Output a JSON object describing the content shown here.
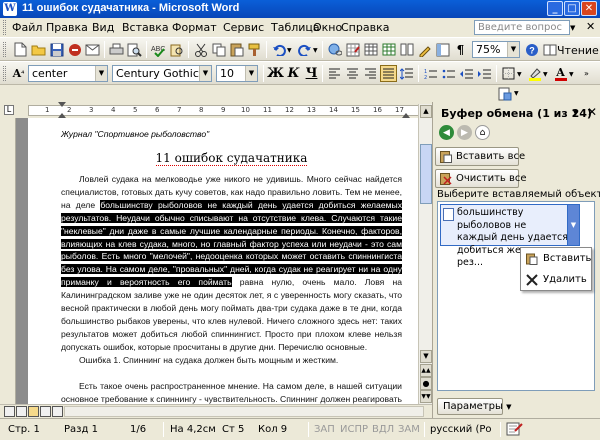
{
  "window": {
    "title": "11 ошибок судачатника - Microsoft Word"
  },
  "menu": {
    "items": [
      "Файл",
      "Правка",
      "Вид",
      "Вставка",
      "Формат",
      "Сервис",
      "Таблица",
      "Окно",
      "Справка"
    ],
    "help_placeholder": "Введите вопрос"
  },
  "standard_toolbar": {
    "zoom": "75%",
    "read_label": "Чтение"
  },
  "formatting_toolbar": {
    "style": "center",
    "font": "Century Gothic",
    "size": "10"
  },
  "ruler": {
    "numbers": [
      "1",
      "2",
      "3",
      "4",
      "5",
      "6",
      "7",
      "8",
      "9",
      "10",
      "11",
      "12",
      "13",
      "14",
      "15",
      "16",
      "17"
    ]
  },
  "document": {
    "journal": "Журнал \"Спортивное рыболовство\"",
    "title": "11 ошибок судачатника",
    "p1_before": "Ловлей судака на мелководье уже никого не удивишь. Много сейчас найдется специалистов, готовых дать кучу советов, как надо правильно ловить. Тем не менее, на деле ",
    "p1_selected": "большинству рыболовов не каждый день удается добиться желаемых результатов. Неудачи обычно списывают на отсутствие клева. Случаются такие \"неклевые\" дни даже в самые лучшие календарные периоды. Конечно, факторов, влияющих на клев судака, много, но главный фактор успеха или неудачи - это сам рыболов. Есть много \"мелочей\", недооценка которых может оставить спиннингиста без улова. На самом деле, \"провальных\" дней, когда судак не реагирует ни на одну приманку и вероятность его поймать",
    "p1_after": " равна нулю, очень мало. Ловя на Калининградском заливе уже не один десяток лет, я с уверенность могу сказать, что весной практически в любой день могу поймать два-три судака даже в те дни, когда большинство рыбаков уверены, что клев нулевой. Ничего сложного здесь нет: таких результатов может добиться любой спиннингист. Просто при плохом клеве нельзя допускать ошибок, которые просчитаны в другие дни. Перечислю основные.",
    "p2": "Ошибка 1. Спиннинг на судака должен быть мощным и жестким.",
    "p3": "Есть такое очень распространенное мнение. На самом деле, в нашей ситуации основное требование к спиннингу - чувствительность. Спиннинг должен реагировать на малейший контакт приманки с дном, чтобы рыболов понимал, что тот находится и приманку можно подсечь."
  },
  "task_pane": {
    "title": "Буфер обмена (1 из 24)",
    "paste_all": "Вставить все",
    "clear_all": "Очистить все",
    "choose_label": "Выберите вставляемый объект:",
    "clip_item": "большинству рыболовов не каждый день удается добиться желаемых рез...",
    "ctx_paste": "Вставить",
    "ctx_delete": "Удалить",
    "params": "Параметры"
  },
  "status_bar": {
    "page": "Стр. 1",
    "section": "Разд 1",
    "pages": "1/6",
    "at": "На 4,2см",
    "line": "Ст 5",
    "col": "Кол 9",
    "rec": "ЗАП",
    "trk": "ИСПР",
    "ext": "ВДЛ",
    "ovr": "ЗАМ",
    "lang": "русский (Ро"
  },
  "colors": {
    "accent": "#0a5fd8",
    "highlight": "#000000",
    "font_color": "#d00000"
  }
}
